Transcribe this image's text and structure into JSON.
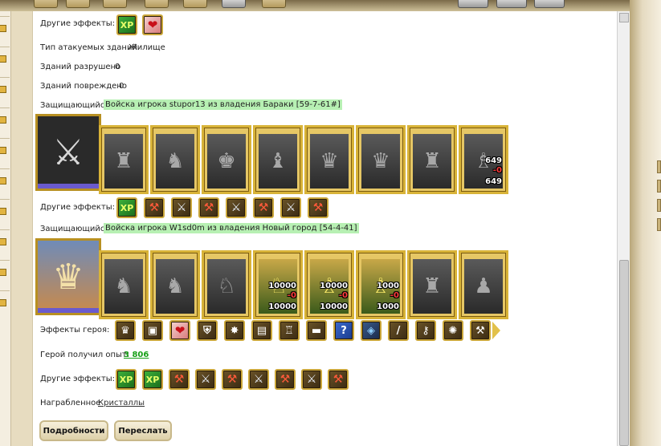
{
  "sections": {
    "other_effects_1": "Другие эффекты:",
    "buildings_type_label": "Тип атакуемых зданий",
    "buildings_type_value": "Жилище",
    "destroyed_label": "Зданий разрушено",
    "destroyed_value": "0",
    "damaged_label": "Зданий повреждено",
    "damaged_value": "0",
    "defender_label_1": "Защищающийся",
    "defender_value_1": "Войска игрока stupor13 из владения Бараки [59-7-61#]",
    "other_effects_2": "Другие эффекты:",
    "defender_label_2": "Защищающийся",
    "defender_value_2": "Войска игрока W1sd0m из владения Новый город [54-4-41]",
    "hero_effects_label": "Эффекты героя:",
    "exp_label": "Герой получил опыт:",
    "exp_value": "3 806",
    "other_effects_3": "Другие эффекты:",
    "reward_label": "Награбленное",
    "reward_value": "Кристаллы"
  },
  "fx_row1": [
    {
      "icon": "xp-icon",
      "glyph": "XP"
    },
    {
      "icon": "heart-icon",
      "glyph": "❤"
    }
  ],
  "units_row1": [
    {
      "icon": "dwarf-warrior-icon",
      "glyph": "♜"
    },
    {
      "icon": "dark-knight-icon",
      "glyph": "♞"
    },
    {
      "icon": "swordsman-icon",
      "glyph": "♚"
    },
    {
      "icon": "griffin-icon",
      "glyph": "♝"
    },
    {
      "icon": "archer-icon",
      "glyph": "♛"
    },
    {
      "icon": "priestess-icon",
      "glyph": "♛"
    },
    {
      "icon": "armored-knight-icon",
      "glyph": "♜"
    },
    {
      "icon": "druid-icon",
      "glyph": "♗",
      "top": "649",
      "mid": "-0",
      "bot": "649"
    }
  ],
  "fx_row2": [
    {
      "icon": "xp-icon",
      "glyph": "XP"
    },
    {
      "icon": "axe-icon",
      "glyph": "⚒"
    },
    {
      "icon": "sword-icon",
      "glyph": "⚔"
    },
    {
      "icon": "axe-icon",
      "glyph": "⚒"
    },
    {
      "icon": "sword-icon",
      "glyph": "⚔"
    },
    {
      "icon": "axe-icon",
      "glyph": "⚒"
    },
    {
      "icon": "sword-icon",
      "glyph": "⚔"
    },
    {
      "icon": "axe-icon",
      "glyph": "⚒"
    }
  ],
  "units_row2": [
    {
      "icon": "cavalry-icon",
      "glyph": "♞"
    },
    {
      "icon": "rider-icon",
      "glyph": "♞"
    },
    {
      "icon": "knight-rider-icon",
      "glyph": "♘"
    },
    {
      "icon": "golden-horse-icon",
      "glyph": "♘",
      "top": "10000",
      "mid": "-0",
      "bot": "10000",
      "color": true
    },
    {
      "icon": "crossbowman-icon",
      "glyph": "♗",
      "top": "10000",
      "mid": "-0",
      "bot": "10000",
      "color": true
    },
    {
      "icon": "goblin-mage-icon",
      "glyph": "♗",
      "top": "1000",
      "mid": "-0",
      "bot": "1000",
      "color": true
    },
    {
      "icon": "heavy-knight-icon",
      "glyph": "♜"
    },
    {
      "icon": "reaper-icon",
      "glyph": "♟"
    }
  ],
  "hero_fx": [
    {
      "icon": "shield-crest-icon",
      "glyph": "♛"
    },
    {
      "icon": "chest-icon",
      "glyph": "▣"
    },
    {
      "icon": "heart-icon",
      "glyph": "❤"
    },
    {
      "icon": "shield-icon",
      "glyph": "⛨"
    },
    {
      "icon": "beetle-icon",
      "glyph": "✸"
    },
    {
      "icon": "scroll-icon",
      "glyph": "▤"
    },
    {
      "icon": "armor-icon",
      "glyph": "♖"
    },
    {
      "icon": "anvil-icon",
      "glyph": "▬"
    },
    {
      "icon": "question-icon",
      "glyph": "?"
    },
    {
      "icon": "sapphire-icon",
      "glyph": "◈"
    },
    {
      "icon": "staff-icon",
      "glyph": "/"
    },
    {
      "icon": "key-icon",
      "glyph": "⚷"
    },
    {
      "icon": "paw-icon",
      "glyph": "✺"
    },
    {
      "icon": "hammer-icon",
      "glyph": "⚒"
    }
  ],
  "fx_row3": [
    {
      "icon": "xp-icon",
      "glyph": "XP"
    },
    {
      "icon": "xp-icon",
      "glyph": "XP"
    },
    {
      "icon": "axe-icon",
      "glyph": "⚒"
    },
    {
      "icon": "sword-icon",
      "glyph": "⚔"
    },
    {
      "icon": "axe-icon",
      "glyph": "⚒"
    },
    {
      "icon": "sword-icon",
      "glyph": "⚔"
    },
    {
      "icon": "axe-icon",
      "glyph": "⚒"
    },
    {
      "icon": "sword-icon",
      "glyph": "⚔"
    },
    {
      "icon": "axe-icon",
      "glyph": "⚒"
    }
  ],
  "buttons": {
    "details": "Подробности",
    "forward": "Переслать"
  },
  "heroes": {
    "hero1_icon": "crossed-swords-crest-icon",
    "hero2_icon": "warrior-woman-portrait-icon"
  }
}
